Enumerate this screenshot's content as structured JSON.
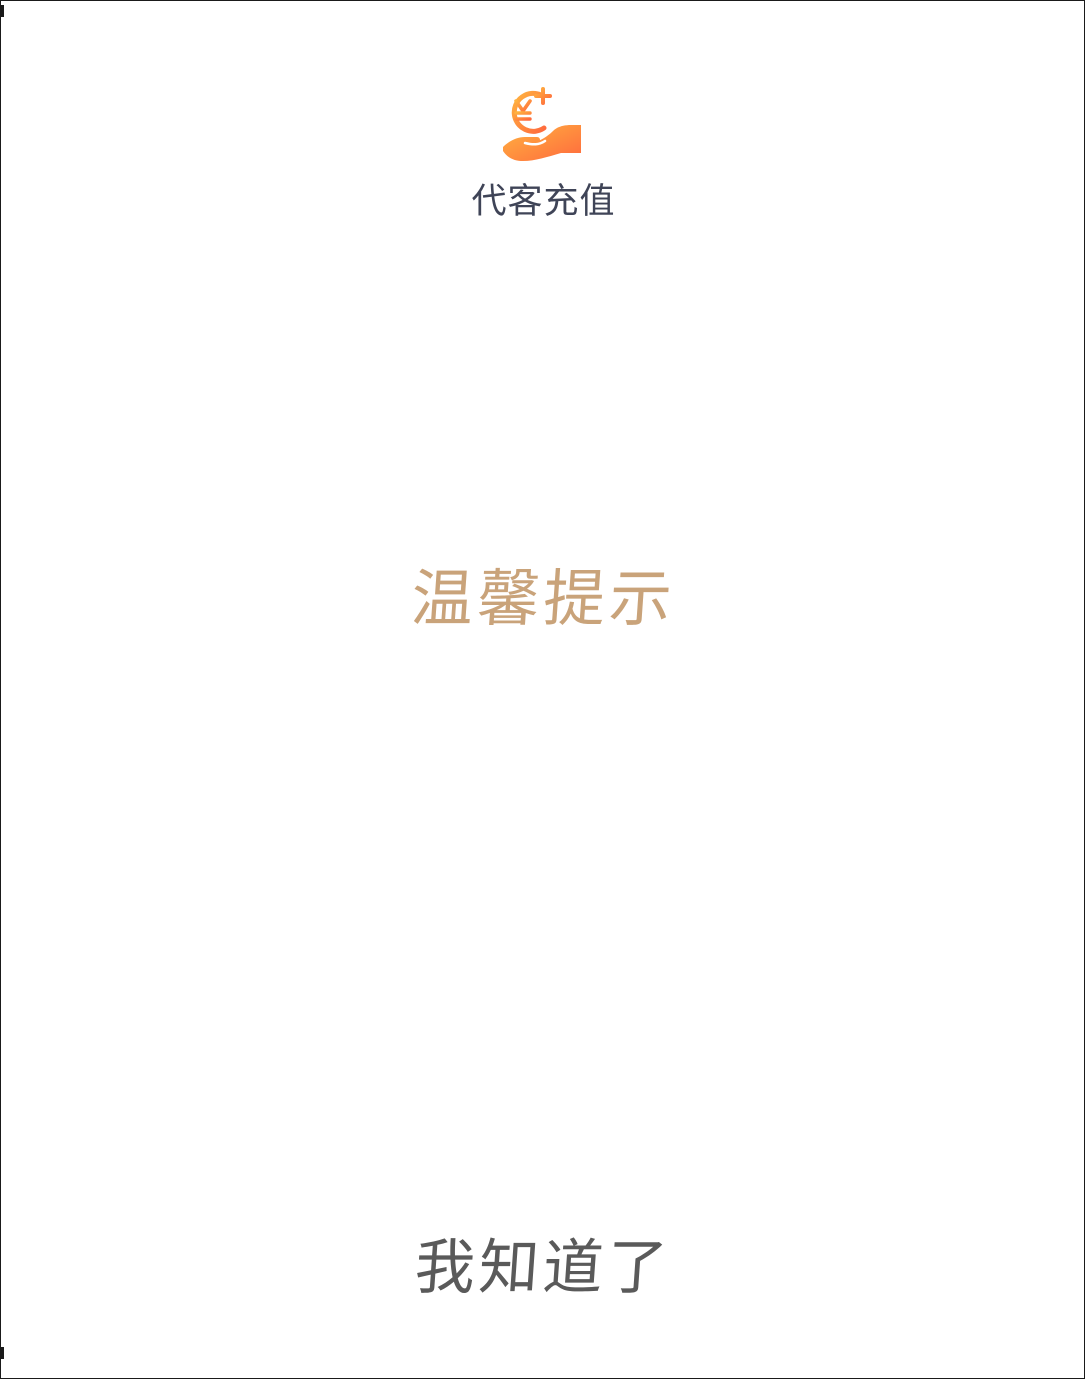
{
  "header": {
    "icon": "yuan-coin-hand-icon",
    "title": "代客充值"
  },
  "notice": {
    "title": "温馨提示"
  },
  "actions": {
    "confirm_label": "我知道了"
  },
  "colors": {
    "title_text": "#3f4457",
    "notice_title": "#c9a37a",
    "confirm_text": "#5a5a5a",
    "icon_gradient_start": "#ffb340",
    "icon_gradient_end": "#ff6a3d"
  }
}
